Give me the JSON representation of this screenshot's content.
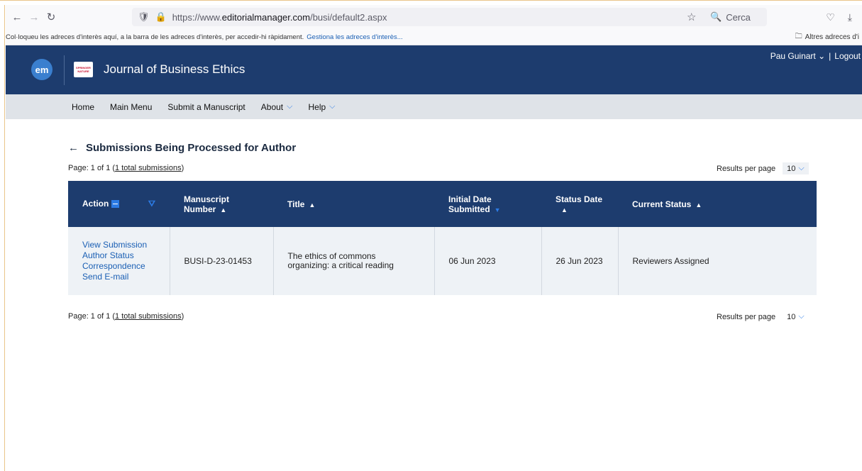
{
  "browser": {
    "url_prefix": "https://www.",
    "url_domain": "editorialmanager.com",
    "url_path": "/busi/default2.aspx",
    "search_placeholder": "Cerca",
    "bookmarks_hint": "Col·loqueu les adreces d'interès aquí, a la barra de les adreces d'interès, per accedir-hi ràpidament.",
    "bookmarks_link": "Gestiona les adreces d'interès...",
    "other_bookmarks": "Altres adreces d'i"
  },
  "header": {
    "em_logo": "em",
    "publisher_line1": "SPRINGER",
    "publisher_line2": "NATURE",
    "journal_title": "Journal of Business Ethics",
    "user_name": "Pau Guinart",
    "separator": "|",
    "logout": "Logout"
  },
  "nav": {
    "items": [
      "Home",
      "Main Menu",
      "Submit a Manuscript",
      "About",
      "Help"
    ]
  },
  "content": {
    "heading": "Submissions Being Processed for Author",
    "page_info_prefix": "Page: 1 of 1 (",
    "page_info_link": "1 total submissions",
    "page_info_suffix": ")",
    "results_per_page_label": "Results per page",
    "results_per_page_value": "10"
  },
  "table": {
    "headers": {
      "action": "Action",
      "manuscript_number_1": "Manuscript",
      "manuscript_number_2": "Number",
      "title": "Title",
      "initial_date_1": "Initial Date",
      "initial_date_2": "Submitted",
      "status_date_1": "Status Date",
      "current_status": "Current Status"
    },
    "rows": [
      {
        "actions": [
          "View Submission",
          "Author Status",
          "Correspondence",
          "Send E-mail"
        ],
        "manuscript_number": "BUSI-D-23-01453",
        "title": "The ethics of commons organizing: a critical reading",
        "initial_date": "06 Jun 2023",
        "status_date": "26 Jun 2023",
        "current_status": "Reviewers Assigned"
      }
    ]
  },
  "colors": {
    "header_navy": "#1d3c6e",
    "link_blue": "#1a5fb4",
    "accent_blue": "#2c7be5"
  }
}
